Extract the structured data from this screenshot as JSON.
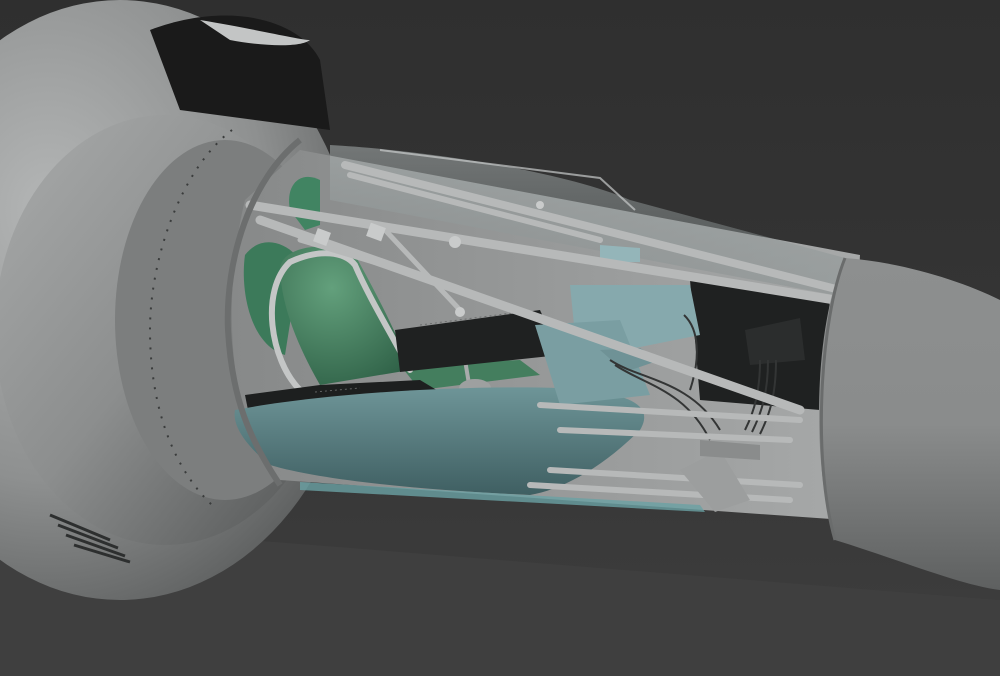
{
  "scene": {
    "subject": "",
    "colors": {
      "background_top": "#313131",
      "background_bottom": "#3d3d3d",
      "hull_light": "#a2a4a4",
      "hull_mid": "#8a8c8c",
      "hull_dark": "#5d5f5f",
      "canopy_glass": "#9aa3a3",
      "frame_tube": "#b6b8b8",
      "seat_green": "#4f8f6a",
      "panel_teal": "#5e8a8e",
      "avionics_blue": "#7fa2a6",
      "electronics_black": "#202222"
    }
  }
}
